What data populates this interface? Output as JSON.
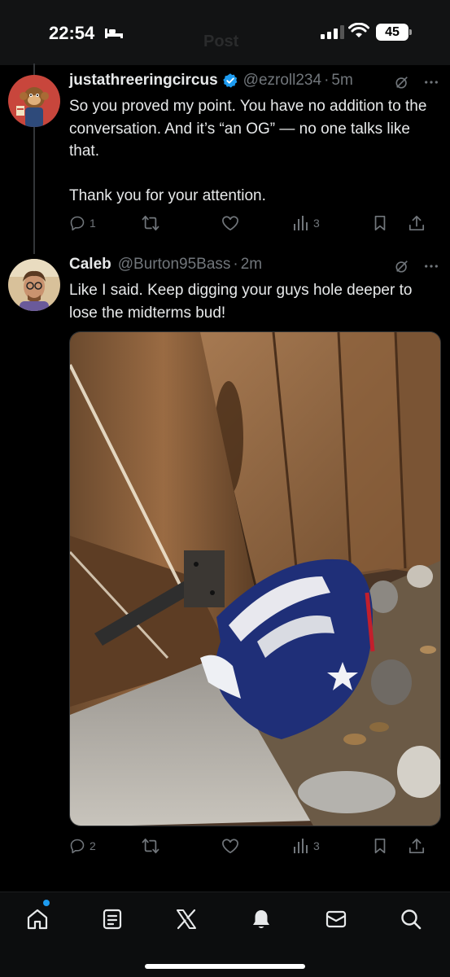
{
  "status_bar": {
    "time": "22:54",
    "battery": "45",
    "background_title": "Post"
  },
  "tweets": [
    {
      "name": "justathreeringcircus",
      "handle": "@ezroll234",
      "separator": "·",
      "time": "5m",
      "verified": true,
      "text": "So you proved my point. You have no addition to the conversation. And it’s “an OG” — no one talks like that.\n\nThank you for your attention.",
      "replies": "1",
      "reposts": "",
      "likes": "",
      "views": "3"
    },
    {
      "name": "Caleb",
      "handle": "@Burton95Bass",
      "separator": "·",
      "time": "2m",
      "verified": false,
      "text": "Like I said. Keep digging your guys hole deeper to lose the midterms bud!",
      "replies": "2",
      "reposts": "",
      "likes": "",
      "views": "3",
      "media": "photo-of-crumpled-flag-by-wooden-fence"
    }
  ],
  "tab_bar": [
    "home-icon",
    "notes-icon",
    "x-logo-icon",
    "bell-icon",
    "mail-icon",
    "search-icon"
  ],
  "colors": {
    "accent": "#1d9bf0",
    "muted": "#71767b",
    "text": "#e7e9ea"
  }
}
